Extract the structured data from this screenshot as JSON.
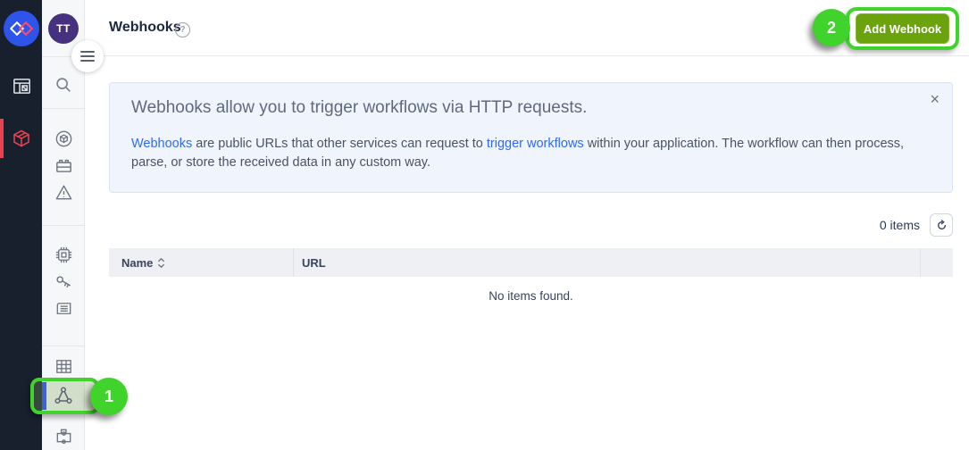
{
  "sidebar": {
    "avatar_initials": "TT"
  },
  "header": {
    "title": "Webhooks",
    "help": "?",
    "add_button": "Add Webhook"
  },
  "banner": {
    "heading": "Webhooks allow you to trigger workflows via HTTP requests.",
    "close": "×",
    "link_webhooks": "Webhooks",
    "text_mid1": " are public URLs that other services can request to ",
    "link_trigger": "trigger workflows",
    "text_mid2": " within your application. The workflow can then process, parse, or store the received data in any custom way."
  },
  "list": {
    "count": "0 items",
    "columns": [
      {
        "label": "Name",
        "sortable": true
      },
      {
        "label": "URL",
        "sortable": false
      }
    ],
    "empty": "No items found."
  },
  "annotations": {
    "step1": "1",
    "step2": "2"
  },
  "colors": {
    "annotation_green": "#3fd32c",
    "button_green": "#6aa30c",
    "sidebar_dark": "#18202e",
    "brand_blue": "#2f54eb",
    "brand_red": "#e8404f",
    "active_blue": "#3b62d9",
    "link_blue": "#2f6bf2"
  }
}
